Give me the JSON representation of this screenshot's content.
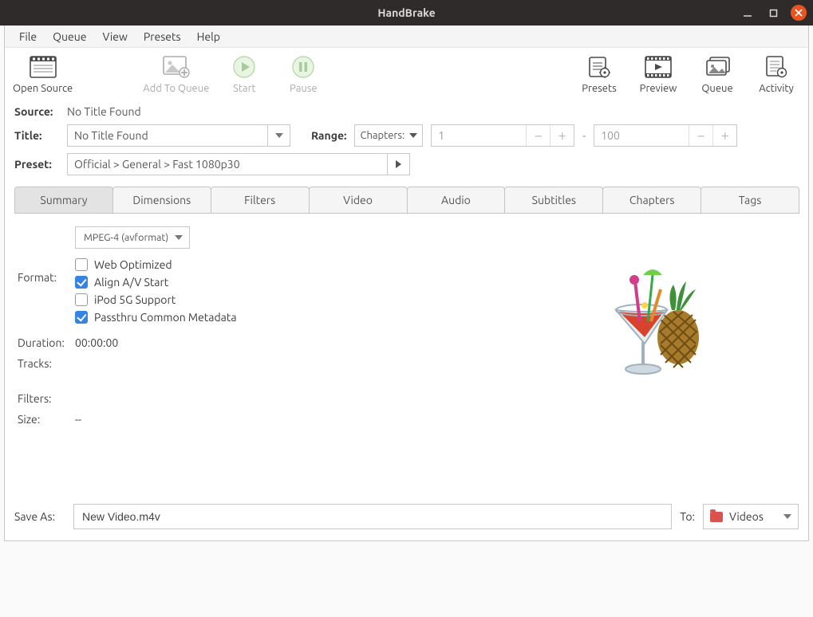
{
  "window": {
    "title": "HandBrake"
  },
  "menu": {
    "items": [
      "File",
      "Queue",
      "View",
      "Presets",
      "Help"
    ]
  },
  "toolbar": {
    "open": "Open Source",
    "add": "Add To Queue",
    "start": "Start",
    "pause": "Pause",
    "presets": "Presets",
    "preview": "Preview",
    "queue": "Queue",
    "activity": "Activity"
  },
  "source": {
    "label": "Source:",
    "value": "No Title Found"
  },
  "title": {
    "label": "Title:",
    "value": "No Title Found"
  },
  "range": {
    "label": "Range:",
    "mode": "Chapters:",
    "from": "1",
    "to": "100",
    "sep": "-"
  },
  "preset": {
    "label": "Preset:",
    "value": "Official > General > Fast 1080p30"
  },
  "tabs": [
    "Summary",
    "Dimensions",
    "Filters",
    "Video",
    "Audio",
    "Subtitles",
    "Chapters",
    "Tags"
  ],
  "summary": {
    "format_label": "Format:",
    "format_value": "MPEG-4 (avformat)",
    "opts": {
      "web": "Web Optimized",
      "av": "Align A/V Start",
      "ipod": "iPod 5G Support",
      "meta": "Passthru Common Metadata"
    },
    "duration_label": "Duration:",
    "duration_value": "00:00:00",
    "tracks_label": "Tracks:",
    "filters_label": "Filters:",
    "size_label": "Size:",
    "size_value": "--"
  },
  "save": {
    "label": "Save As:",
    "value": "New Video.m4v",
    "to_label": "To:",
    "dest": "Videos"
  }
}
